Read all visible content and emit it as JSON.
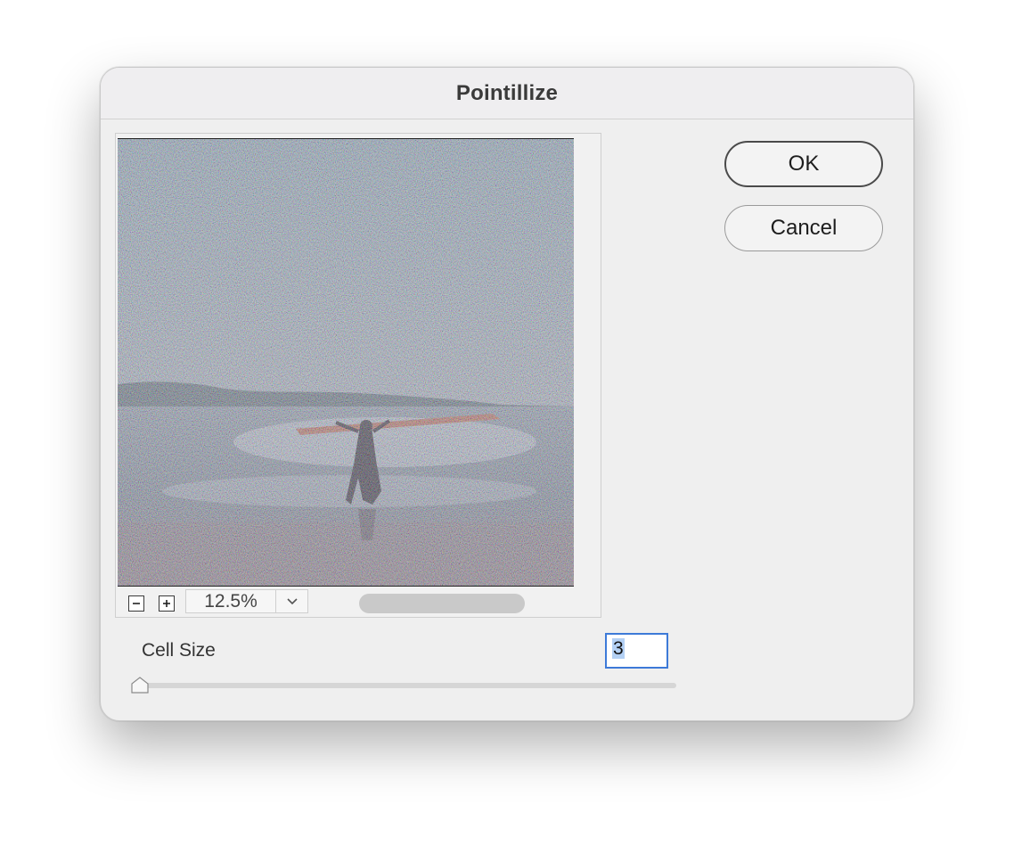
{
  "dialog": {
    "title": "Pointillize",
    "preview": {
      "image_description": "pointillized beach scene with a person carrying a surfboard overhead",
      "zoom_value": "12.5%",
      "zoom_out_icon": "minus-icon",
      "zoom_in_icon": "plus-icon",
      "zoom_menu_icon": "chevron-down-icon"
    },
    "buttons": {
      "ok_label": "OK",
      "cancel_label": "Cancel"
    },
    "cell_size": {
      "label": "Cell Size",
      "value": "3",
      "slider_fraction": 0.0
    }
  },
  "colors": {
    "dialog_bg": "#efefef",
    "focus_ring": "#3d7ad8",
    "selection": "#b3d0f4"
  }
}
